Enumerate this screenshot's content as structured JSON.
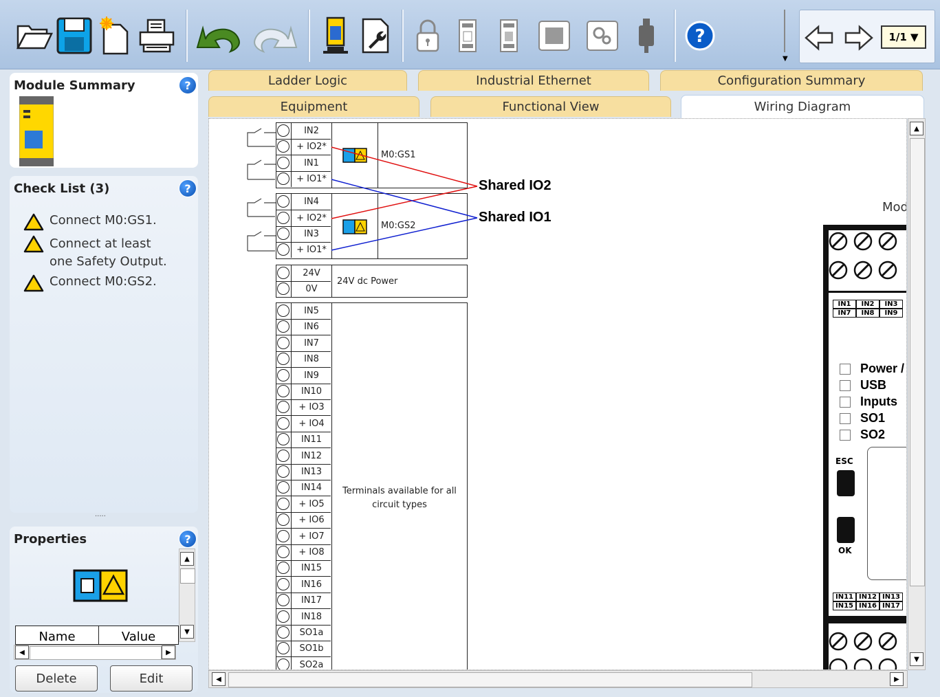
{
  "toolbar": {
    "icons": [
      "open-folder-icon",
      "save-icon",
      "new-project-icon",
      "print-icon",
      "undo-icon",
      "redo-icon",
      "connect-device-icon",
      "edit-wrench-icon",
      "lock-icon",
      "module-a-icon",
      "module-b-icon",
      "chip-icon",
      "gear-icon",
      "usb-icon",
      "help-icon"
    ],
    "page": "1/1 ▼"
  },
  "module_summary": {
    "title": "Module Summary"
  },
  "check_list": {
    "title": "Check List (3)",
    "items": [
      "Connect M0:GS1.",
      "Connect at least one Safety Output.",
      "Connect M0:GS2."
    ]
  },
  "properties": {
    "title": "Properties",
    "columns": [
      "Name",
      "Value"
    ],
    "delete_label": "Delete",
    "edit_label": "Edit"
  },
  "splitter": "·····",
  "tabs": {
    "row1": [
      "Ladder Logic",
      "Industrial Ethernet",
      "Configuration Summary"
    ],
    "row2": [
      "Equipment",
      "Functional View",
      "Wiring Diagram"
    ],
    "active": "Wiring Diagram"
  },
  "diagram": {
    "gs1": {
      "terminals": [
        "IN2",
        "+ IO2*",
        "IN1",
        "+ IO1*"
      ],
      "label": "M0:GS1"
    },
    "gs2": {
      "terminals": [
        "IN4",
        "+ IO2*",
        "IN3",
        "+ IO1*"
      ],
      "label": "M0:GS2"
    },
    "power": {
      "terminals": [
        "24V",
        "0V"
      ],
      "label": "24V dc Power"
    },
    "general": {
      "terminals": [
        "IN5",
        "IN6",
        "IN7",
        "IN8",
        "IN9",
        "IN10",
        "+ IO3",
        "+ IO4",
        "IN11",
        "IN12",
        "IN13",
        "IN14",
        "+ IO5",
        "+ IO6",
        "+ IO7",
        "+ IO8",
        "IN15",
        "IN16",
        "IN17",
        "IN18",
        "SO1a",
        "SO1b",
        "SO2a"
      ],
      "label_line1": "Terminals available for all",
      "label_line2": "circuit types"
    },
    "callouts": {
      "io2": "Shared IO2",
      "io1": "Shared IO1"
    },
    "line_colors": {
      "io2": "#e01010",
      "io1": "#1020d0"
    }
  },
  "device": {
    "title": "Mod",
    "top_inputs": [
      [
        "IN1",
        "IN2",
        "IN3"
      ],
      [
        "IN7",
        "IN8",
        "IN9"
      ]
    ],
    "leds": [
      "Power / I",
      "USB",
      "Inputs",
      "SO1",
      "SO2"
    ],
    "esc_label": "ESC",
    "ok_label": "OK",
    "bottom_inputs": [
      [
        "IN11",
        "IN12",
        "IN13"
      ],
      [
        "IN15",
        "IN16",
        "IN17"
      ]
    ]
  }
}
